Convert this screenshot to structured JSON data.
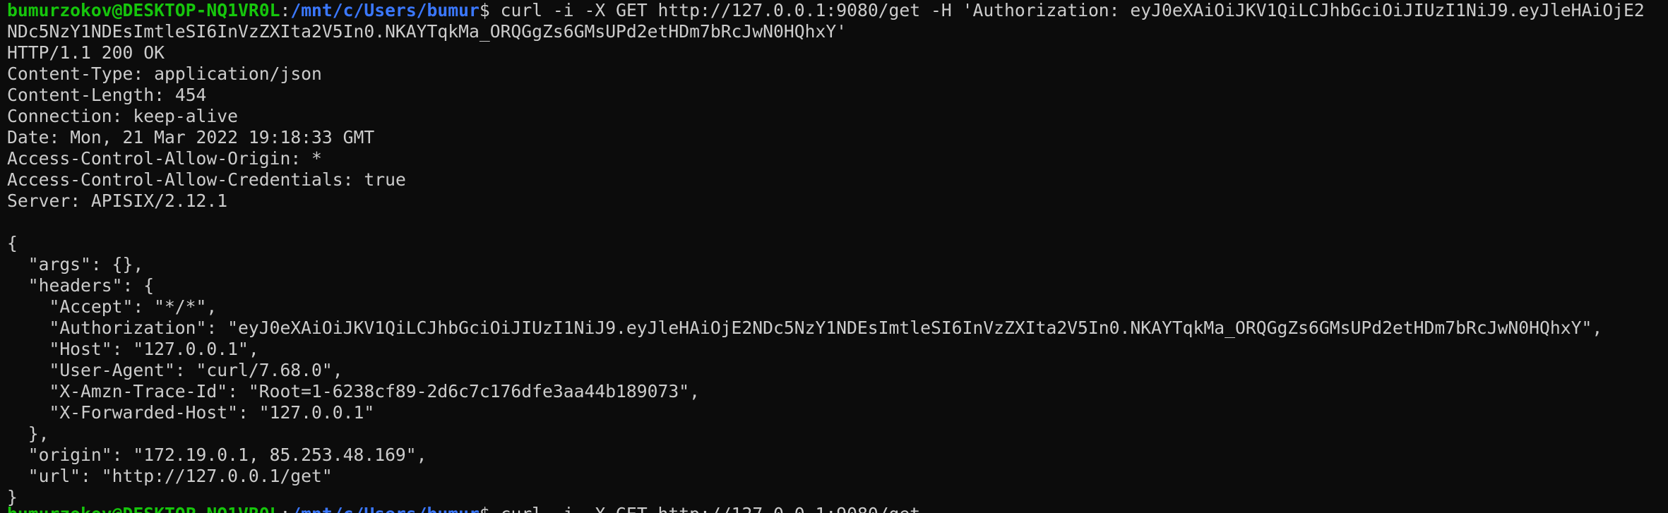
{
  "prompt": {
    "user_host": "bumurzokov@DESKTOP-NQ1VR0L",
    "colon": ":",
    "path": "/mnt/c/Users/bumur",
    "symbol": "$ "
  },
  "command": {
    "line1": "curl -i -X GET http://127.0.0.1:9080/get -H 'Authorization: eyJ0eXAiOiJKV1QiLCJhbGciOiJIUzI1NiJ9.eyJleHAiOjE2",
    "line2": "NDc5NzY1NDEsImtleSI6InVzZXIta2V5In0.NKAYTqkMa_ORQGgZs6GMsUPd2etHDm7bRcJwN0HQhxY'"
  },
  "response_headers": [
    {
      "text": "HTTP/1.1 200 OK"
    },
    {
      "key": "Content-Type",
      "value": "application/json"
    },
    {
      "key": "Content-Length",
      "value": "454"
    },
    {
      "key": "Connection",
      "value": "keep-alive"
    },
    {
      "key": "Date",
      "value": "Mon, 21 Mar 2022 19:18:33 GMT"
    },
    {
      "key": "Access-Control-Allow-Origin",
      "value": "*"
    },
    {
      "key": "Access-Control-Allow-Credentials",
      "value": "true"
    },
    {
      "key": "Server",
      "value": "APISIX/2.12.1"
    }
  ],
  "body_lines": [
    "{",
    "  \"args\": {},",
    "  \"headers\": {",
    "    \"Accept\": \"*/*\",",
    "    \"Authorization\": \"eyJ0eXAiOiJKV1QiLCJhbGciOiJIUzI1NiJ9.eyJleHAiOjE2NDc5NzY1NDEsImtleSI6InVzZXIta2V5In0.NKAYTqkMa_ORQGgZs6GMsUPd2etHDm7bRcJwN0HQhxY\",",
    "    \"Host\": \"127.0.0.1\",",
    "    \"User-Agent\": \"curl/7.68.0\",",
    "    \"X-Amzn-Trace-Id\": \"Root=1-6238cf89-2d6c7c176dfe3aa44b189073\",",
    "    \"X-Forwarded-Host\": \"127.0.0.1\"",
    "  },",
    "  \"origin\": \"172.19.0.1, 85.253.48.169\",",
    "  \"url\": \"http://127.0.0.1/get\"",
    "}"
  ],
  "next_command_partial": "curl -i -X GET http://127.0.0.1:9080/get"
}
